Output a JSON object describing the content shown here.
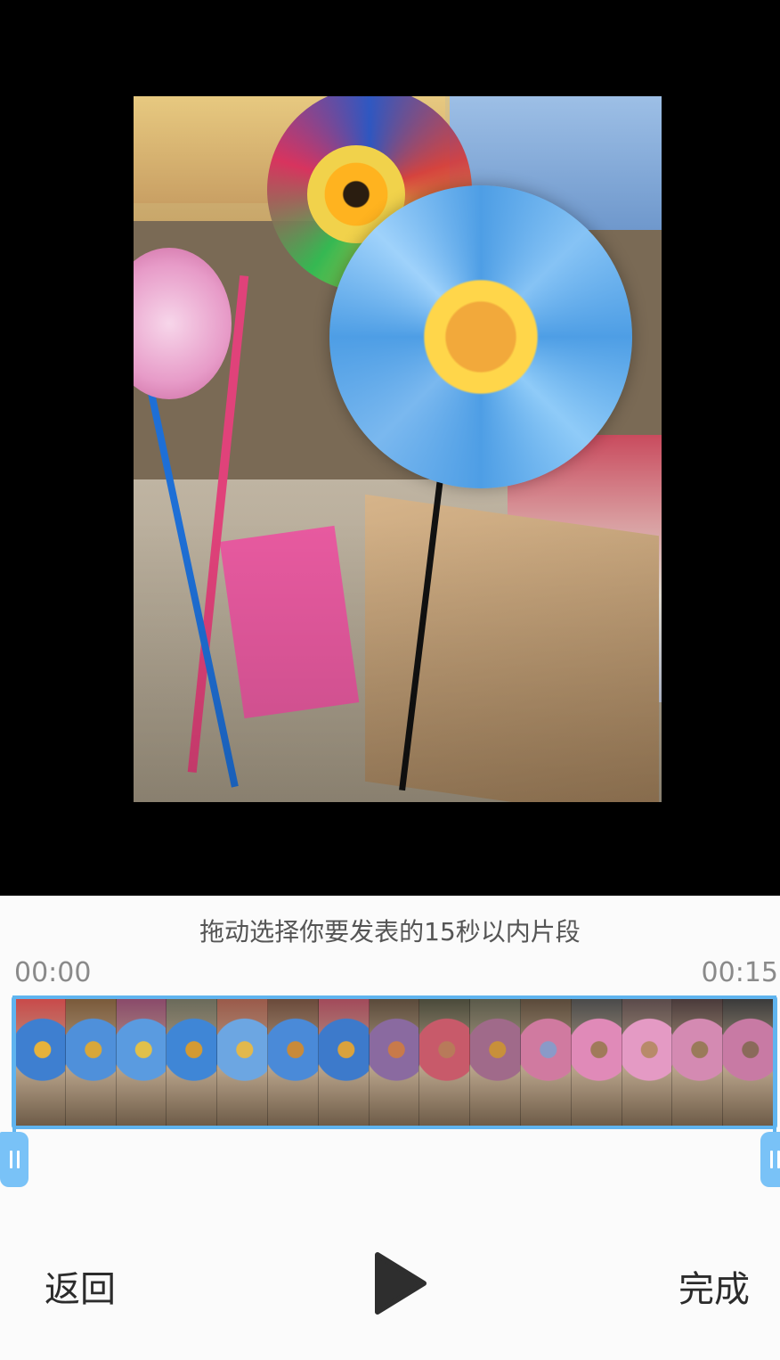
{
  "editor": {
    "hint": "拖动选择你要发表的15秒以内片段",
    "time_start": "00:00",
    "time_end": "00:15"
  },
  "actions": {
    "back_label": "返回",
    "done_label": "完成",
    "play_icon": "play-icon"
  },
  "filmstrip": {
    "frame_count": 15
  },
  "colors": {
    "accent": "#5fb4ef",
    "handle": "#79c2f7",
    "preview_bg": "#000000",
    "panel_bg": "#fbfbfb"
  }
}
